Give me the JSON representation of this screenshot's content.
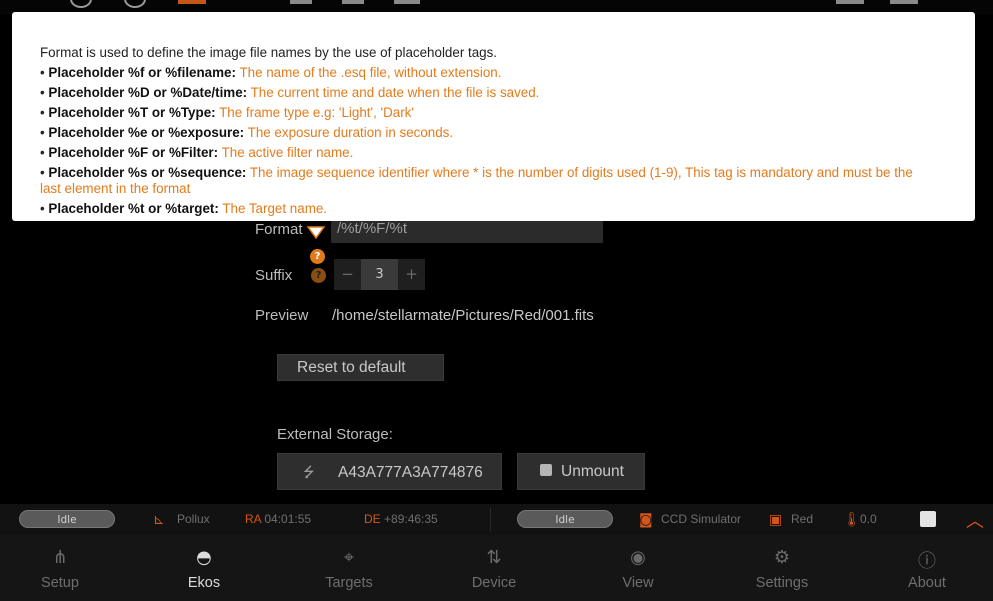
{
  "tooltip": {
    "intro": "Format is used to define the image file names by the use of placeholder tags.",
    "items": [
      {
        "tag": "Placeholder %f or %filename:",
        "desc": "The name of the .esq file, without extension."
      },
      {
        "tag": "Placeholder %D or %Date/time:",
        "desc": "The current time and date when the file is saved."
      },
      {
        "tag": "Placeholder %T or %Type:",
        "desc": "The frame type e.g: 'Light', 'Dark'"
      },
      {
        "tag": "Placeholder %e or %exposure:",
        "desc": "The exposure duration in seconds."
      },
      {
        "tag": "Placeholder %F or %Filter:",
        "desc": "The active filter name."
      },
      {
        "tag": "Placeholder %s or %sequence:",
        "desc": "The image sequence identifier where * is the number of digits used (1-9), This tag is mandatory and must be the",
        "desc_cont": "last element in the format"
      },
      {
        "tag": "Placeholder %t or %target:",
        "desc": "The Target name."
      }
    ]
  },
  "form": {
    "format_label": "Format",
    "format_value": "/%t/%F/%t",
    "help_icon": "question-icon",
    "suffix_label": "Suffix",
    "suffix_value": "3",
    "decrement": "−",
    "increment": "+",
    "preview_label": "Preview",
    "preview_value": "/home/stellarmate/Pictures/Red/001.fits",
    "reset_label": "Reset to default",
    "external_storage_label": "External Storage:",
    "storage_id": "A43A777A3A774876",
    "unmount_label": "Unmount"
  },
  "status": {
    "mount_state": "Idle",
    "mount_name": "Pollux",
    "ra_label": "RA",
    "ra_value": "04:01:55",
    "de_label": "DE",
    "de_value": "+89:46:35",
    "camera_state": "Idle",
    "camera_name": "CCD Simulator",
    "filter_name": "Red",
    "temperature": "0.0"
  },
  "nav": {
    "items": [
      {
        "label": "Setup",
        "icon": "network-icon"
      },
      {
        "label": "Ekos",
        "icon": "observatory-icon"
      },
      {
        "label": "Targets",
        "icon": "crosshair-icon"
      },
      {
        "label": "Device",
        "icon": "device-icon"
      },
      {
        "label": "View",
        "icon": "eye-icon"
      },
      {
        "label": "Settings",
        "icon": "gear-icon"
      },
      {
        "label": "About",
        "icon": "info-icon"
      }
    ],
    "active": "Ekos"
  },
  "colors": {
    "accent": "#e37b1c",
    "status_orange": "#d2561b",
    "background": "#000000"
  }
}
